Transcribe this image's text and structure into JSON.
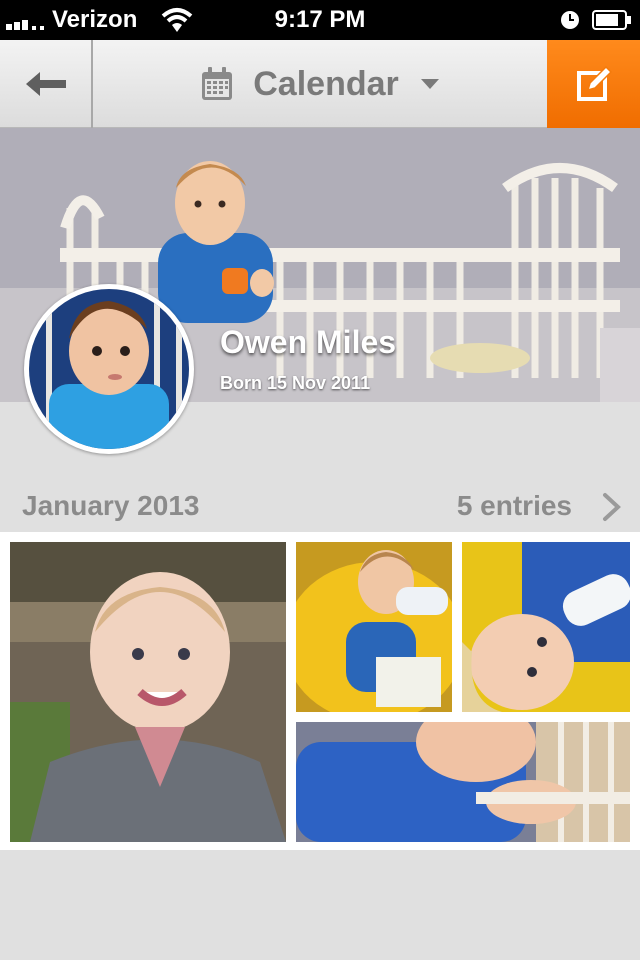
{
  "status_bar": {
    "carrier": "Verizon",
    "time": "9:17 PM",
    "icons": [
      "signal-icon",
      "wifi-icon",
      "clock-icon",
      "battery-icon"
    ]
  },
  "nav": {
    "title": "Calendar",
    "icons": [
      "back-arrow-icon",
      "calendar-icon",
      "dropdown-caret-icon",
      "edit-icon"
    ],
    "accent_color": "#f47b0c"
  },
  "profile": {
    "name": "Owen Miles",
    "born": "Born 15 Nov 2011"
  },
  "month": {
    "label": "January 2013",
    "entries": "5 entries"
  },
  "photos": [
    {
      "subject": "smiling toddler in cardigan"
    },
    {
      "subject": "toddler drinking bottle on yellow pillow"
    },
    {
      "subject": "toddler lying with bottle"
    },
    {
      "subject": "toddler in blue shirt at crib rail"
    }
  ]
}
